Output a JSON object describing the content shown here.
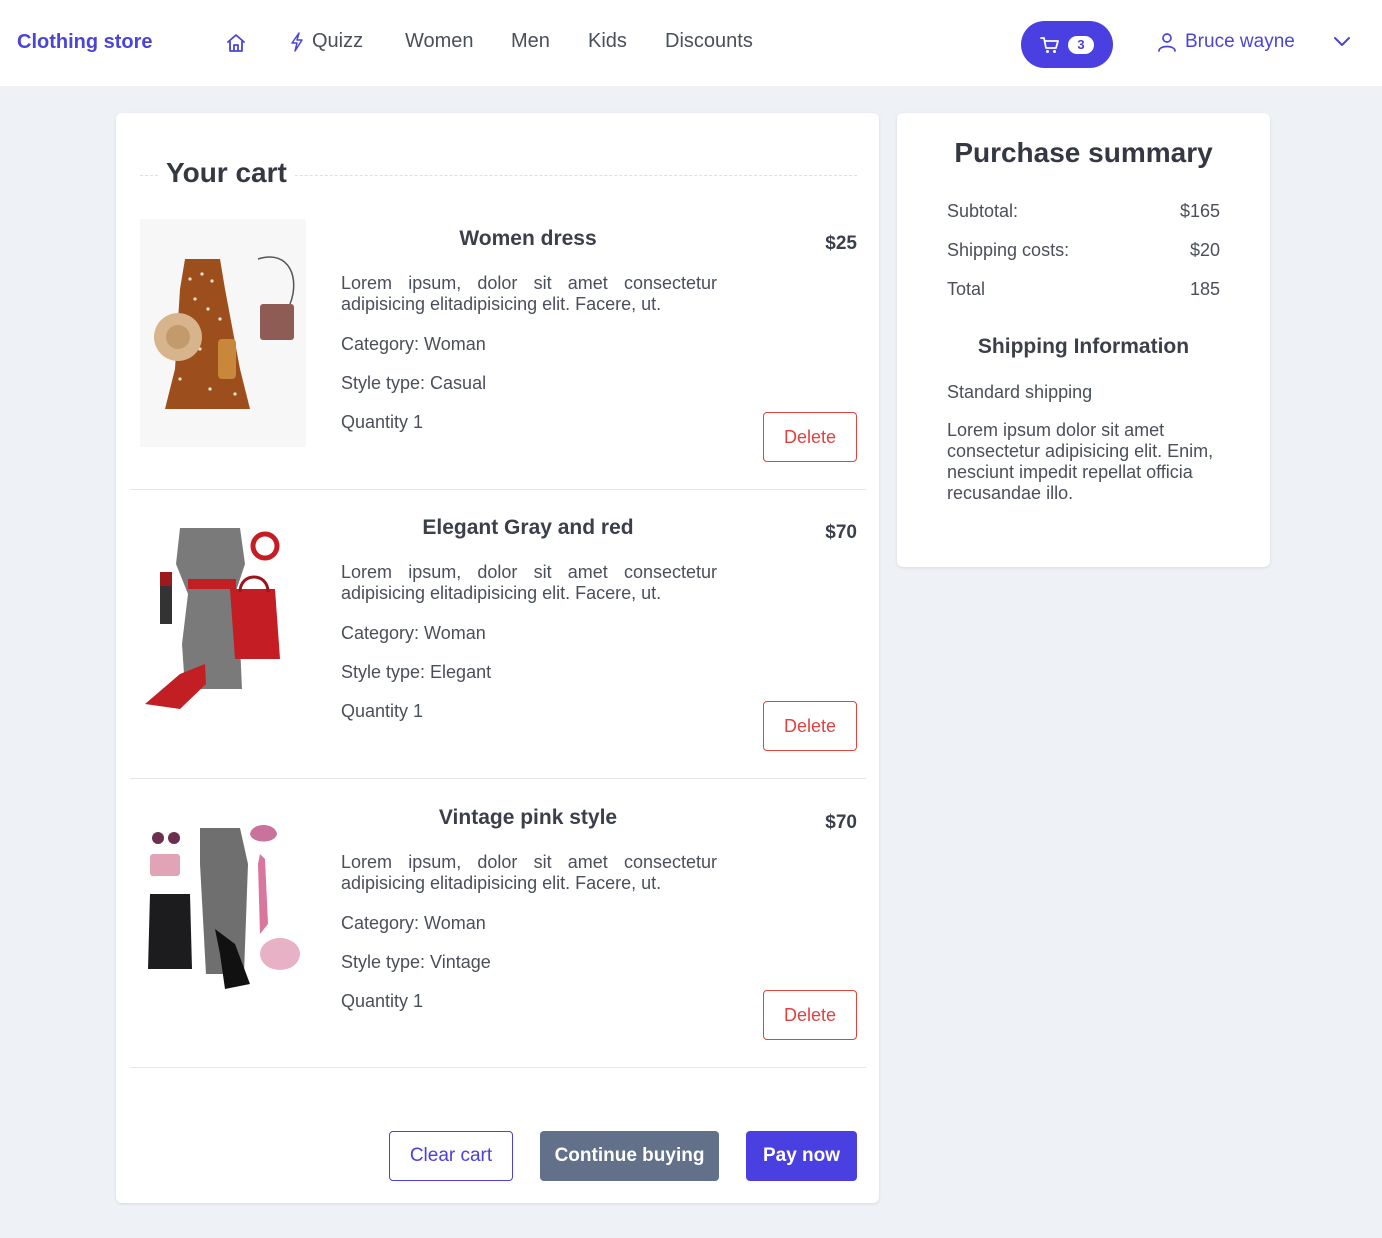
{
  "header": {
    "brand": "Clothing store",
    "nav": {
      "home_icon": "home-icon",
      "quizz": "Quizz",
      "quizz_icon": "lightning-icon",
      "women": "Women",
      "men": "Men",
      "kids": "Kids",
      "discounts": "Discounts"
    },
    "cart": {
      "icon": "cart-icon",
      "count": "3"
    },
    "user": {
      "icon": "user-icon",
      "name": "Bruce wayne",
      "menu_icon": "chevron-down-icon"
    }
  },
  "cart": {
    "title": "Your cart",
    "items": [
      {
        "name": "Women dress",
        "price": "$25",
        "description": "Lorem ipsum, dolor sit amet consectetur adipisicing elitadipisicing elit. Facere, ut.",
        "category": "Category: Woman",
        "style": "Style type: Casual",
        "quantity": "Quantity 1",
        "delete_label": "Delete"
      },
      {
        "name": "Elegant Gray and red",
        "price": "$70",
        "description": "Lorem ipsum, dolor sit amet consectetur adipisicing elitadipisicing elit. Facere, ut.",
        "category": "Category: Woman",
        "style": "Style type: Elegant",
        "quantity": "Quantity 1",
        "delete_label": "Delete"
      },
      {
        "name": "Vintage pink style",
        "price": "$70",
        "description": "Lorem ipsum, dolor sit amet consectetur adipisicing elitadipisicing elit. Facere, ut.",
        "category": "Category: Woman",
        "style": "Style type: Vintage",
        "quantity": "Quantity 1",
        "delete_label": "Delete"
      }
    ],
    "actions": {
      "clear": "Clear cart",
      "continue": "Continue buying",
      "pay": "Pay now"
    }
  },
  "summary": {
    "title": "Purchase summary",
    "subtotal_label": "Subtotal:",
    "subtotal_value": "$165",
    "shipping_label": "Shipping costs:",
    "shipping_value": "$20",
    "total_label": "Total",
    "total_value": "185",
    "shipping_title": "Shipping Information",
    "shipping_type": "Standard shipping",
    "shipping_desc": "Lorem ipsum dolor sit amet consectetur adipisicing elit. Enim, nesciunt impedit repellat officia recusandae illo."
  },
  "colors": {
    "accent": "#4a3fe0",
    "danger": "#e0423f",
    "secondary": "#627089",
    "background": "#eef1f6"
  }
}
